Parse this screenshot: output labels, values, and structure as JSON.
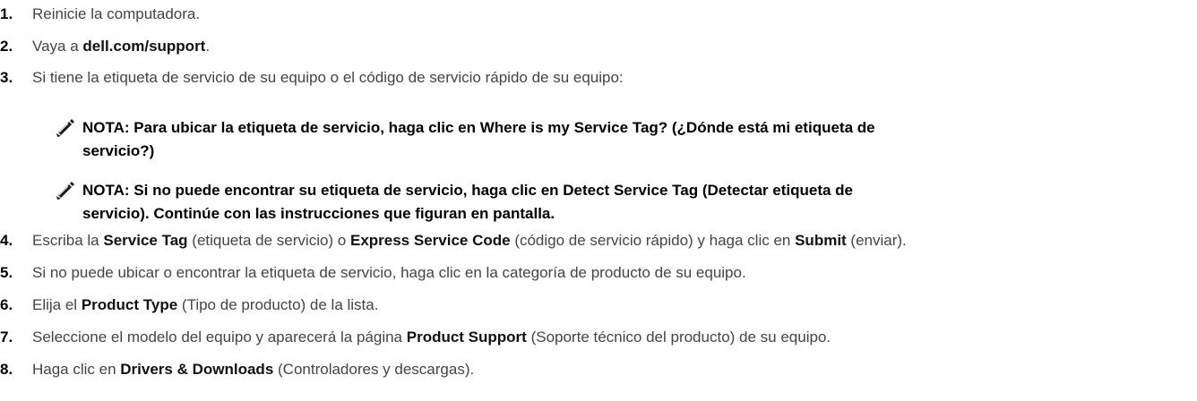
{
  "steps": [
    {
      "num": "1.",
      "parts": [
        "Reinicie la computadora."
      ]
    },
    {
      "num": "2.",
      "parts": [
        "Vaya a ",
        "dell.com/support",
        "."
      ]
    },
    {
      "num": "3.",
      "parts": [
        "Si tiene la etiqueta de servicio de su equipo o el código de servicio rápido de su equipo:"
      ]
    },
    {
      "num": "4.",
      "parts": [
        "Escriba la ",
        "Service Tag",
        " (etiqueta de servicio) o ",
        "Express Service Code",
        " (código de servicio rápido) y haga clic en ",
        "Submit",
        " (enviar)."
      ]
    },
    {
      "num": "5.",
      "parts": [
        "Si no puede ubicar o encontrar la etiqueta de servicio, haga clic en la categoría de producto de su equipo."
      ]
    },
    {
      "num": "6.",
      "parts": [
        "Elija el ",
        "Product Type",
        " (Tipo de producto) de la lista."
      ]
    },
    {
      "num": "7.",
      "parts": [
        "Seleccione el modelo del equipo y aparecerá la página ",
        "Product Support",
        " (Soporte técnico del producto) de su equipo."
      ]
    },
    {
      "num": "8.",
      "parts": [
        "Haga clic en ",
        "Drivers & Downloads",
        " (Controladores y descargas)."
      ]
    }
  ],
  "notes": [
    {
      "icon": "pencil-note-icon",
      "line1": "NOTA: Para ubicar la etiqueta de servicio, haga clic en Where is my Service Tag? (¿Dónde está mi etiqueta de",
      "line2": "servicio?)"
    },
    {
      "icon": "pencil-note-icon",
      "line1": "NOTA: Si no puede encontrar su etiqueta de servicio, haga clic en Detect Service Tag (Detectar etiqueta de",
      "line2": "servicio). Continúe con las instrucciones que figuran en pantalla."
    }
  ]
}
